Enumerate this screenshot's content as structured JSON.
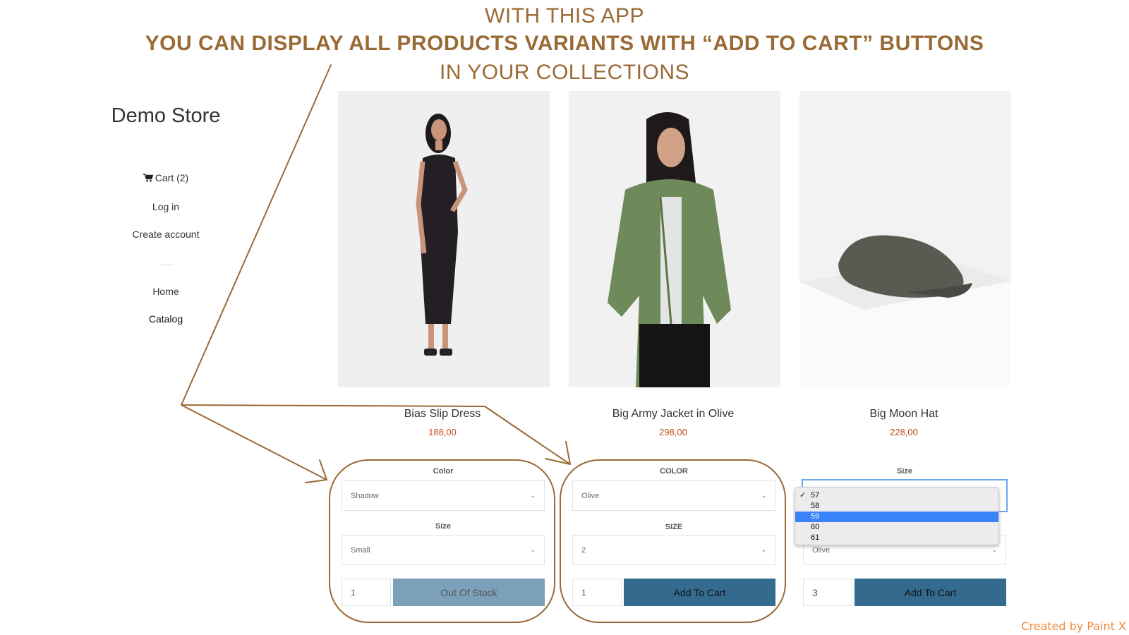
{
  "banner": {
    "line1": "WITH THIS APP",
    "line2": "YOU CAN DISPLAY ALL PRODUCTS VARIANTS WITH “ADD TO CART” BUTTONS",
    "line3": "IN YOUR COLLECTIONS"
  },
  "store": {
    "title": "Demo Store",
    "nav": {
      "cart": "Cart (2)",
      "login": "Log in",
      "create_account": "Create account",
      "home": "Home",
      "catalog": "Catalog"
    }
  },
  "products": [
    {
      "name": "Bias Slip Dress",
      "price": "188,00",
      "image": "woman-in-black-slip-dress",
      "option1_label": "Color",
      "option1_value": "Shadow",
      "option2_label": "Size",
      "option2_value": "Small",
      "quantity": "1",
      "button": "Out Of Stock"
    },
    {
      "name": "Big Army Jacket in Olive",
      "price": "298,00",
      "image": "woman-in-olive-army-jacket",
      "option1_label": "COLOR",
      "option1_value": "Olive",
      "option2_label": "SIZE",
      "option2_value": "2",
      "quantity": "1",
      "button": "Add To Cart"
    },
    {
      "name": "Big Moon Hat",
      "price": "228,00",
      "image": "grey-flat-cap-on-pedestal",
      "option1_label": "Size",
      "option1_value": "57",
      "option2_value": "Olive",
      "quantity": "3",
      "button": "Add To Cart",
      "dropdown": {
        "options": [
          "57",
          "58",
          "59",
          "60",
          "61"
        ],
        "checked": "57",
        "highlighted": "59"
      }
    }
  ],
  "colors": {
    "annotation": "#9a6a35",
    "price": "#c24a1d",
    "add_button": "#356a8f",
    "out_of_stock_button": "#7ba0b9",
    "dropdown_highlight": "#3a82f7"
  },
  "credit": "Created by Paint X"
}
